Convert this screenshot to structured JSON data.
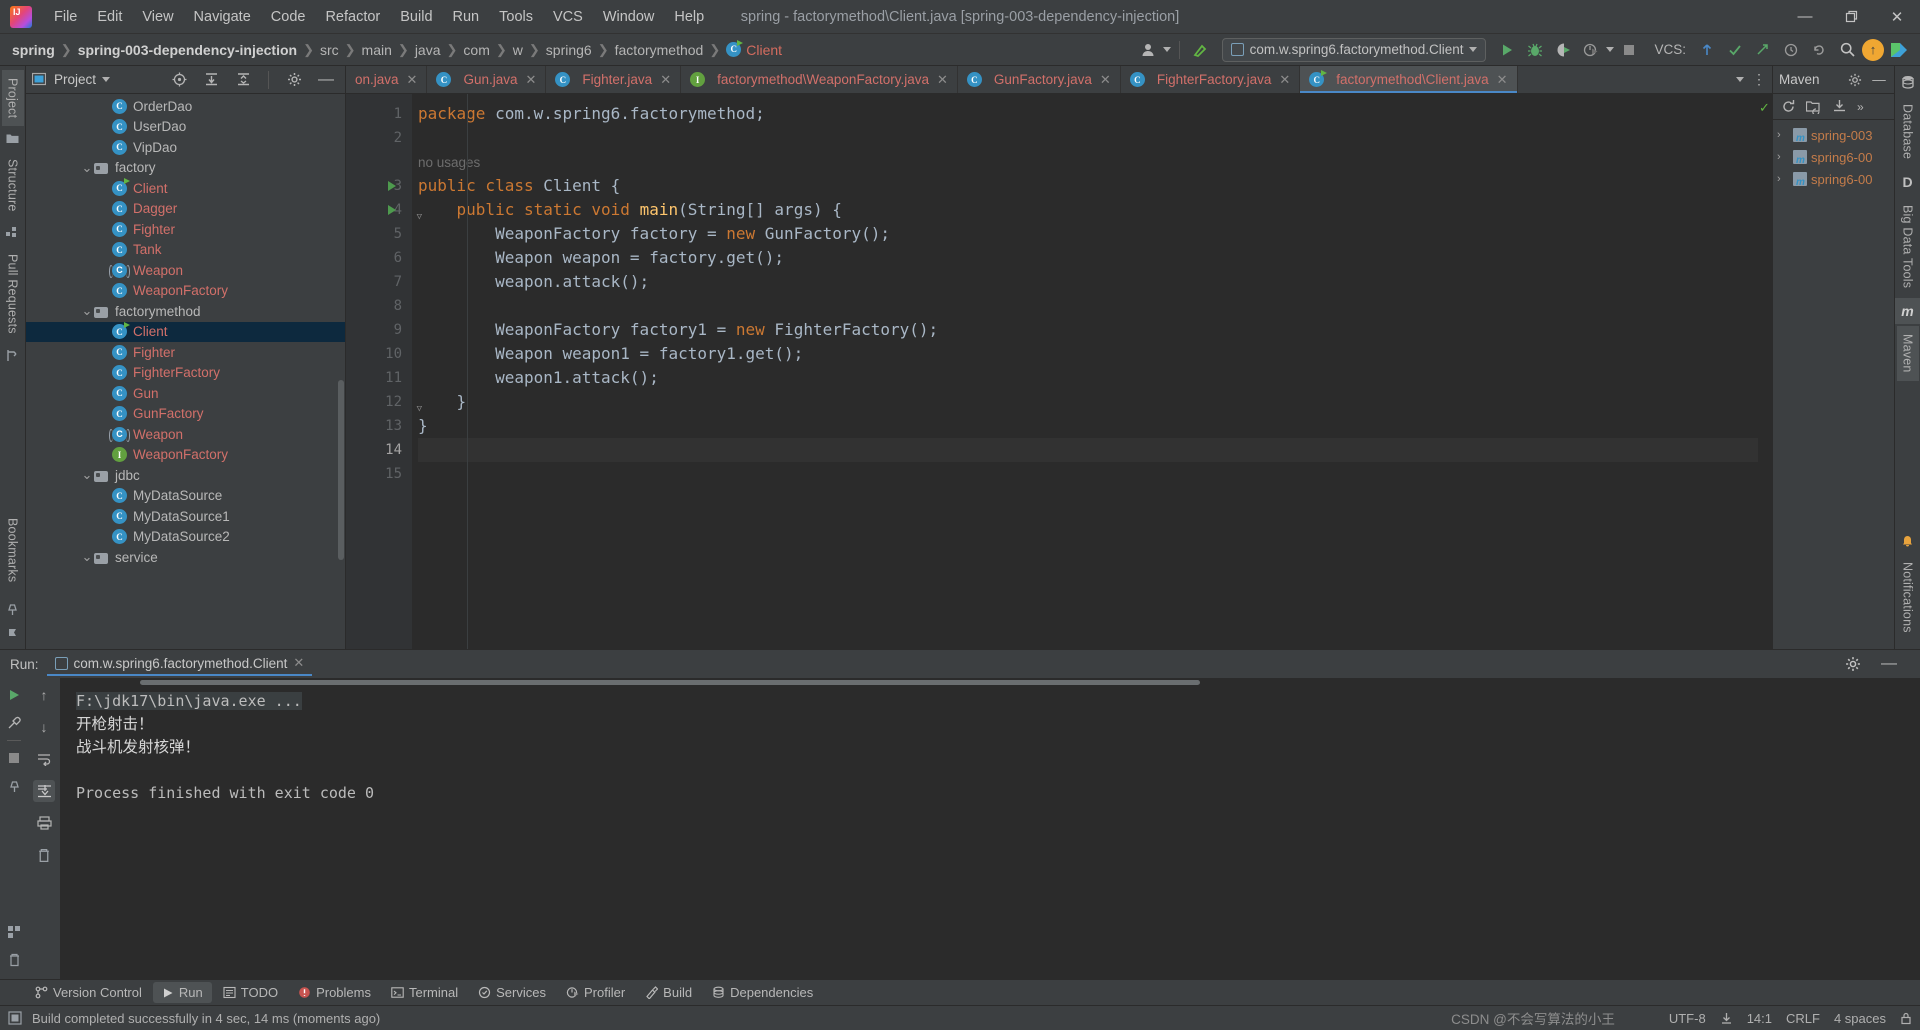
{
  "window": {
    "title": "spring - factorymethod\\Client.java [spring-003-dependency-injection]",
    "minimize": "—",
    "maximize": "❐",
    "close": "✕"
  },
  "menu": [
    "File",
    "Edit",
    "View",
    "Navigate",
    "Code",
    "Refactor",
    "Build",
    "Run",
    "Tools",
    "VCS",
    "Window",
    "Help"
  ],
  "breadcrumbs": [
    {
      "label": "spring",
      "bold": true
    },
    {
      "label": "spring-003-dependency-injection",
      "bold": true
    },
    {
      "label": "src",
      "bold": false
    },
    {
      "label": "main",
      "bold": false
    },
    {
      "label": "java",
      "bold": false
    },
    {
      "label": "com",
      "bold": false
    },
    {
      "label": "w",
      "bold": false
    },
    {
      "label": "spring6",
      "bold": false
    },
    {
      "label": "factorymethod",
      "bold": false
    },
    {
      "label": "Client",
      "bold": false,
      "class": true
    }
  ],
  "toolbar": {
    "run_config": "com.w.spring6.factorymethod.Client",
    "run_tooltip": "Run",
    "debug_tooltip": "Debug",
    "coverage_tooltip": "Run with Coverage",
    "profiler_tooltip": "Profiler",
    "stop_tooltip": "Stop",
    "vcs_label": "VCS:",
    "search_tooltip": "Search Everywhere",
    "update_tooltip": "Update Project",
    "settings_tooltip": "Settings",
    "minimize_panel": "—"
  },
  "left_rail": {
    "items": [
      "Project",
      "Structure",
      "Pull Requests",
      "Bookmarks"
    ],
    "active": "Project"
  },
  "right_rail": {
    "items": [
      "Database",
      "Big Data Tools",
      "Maven",
      "Notifications"
    ]
  },
  "project_panel": {
    "title": "Project",
    "tree": [
      {
        "indent": 4,
        "label": "OrderDao",
        "icon": "class-icon",
        "color": "normal",
        "expander": "",
        "selected": false
      },
      {
        "indent": 4,
        "label": "UserDao",
        "icon": "class-icon",
        "color": "normal",
        "expander": "",
        "selected": false
      },
      {
        "indent": 4,
        "label": "VipDao",
        "icon": "class-icon",
        "color": "normal",
        "expander": "",
        "selected": false
      },
      {
        "indent": 3,
        "label": "factory",
        "icon": "folder-icon",
        "color": "normal",
        "expander": "v",
        "selected": false
      },
      {
        "indent": 4,
        "label": "Client",
        "icon": "class-runnable-icon",
        "color": "red",
        "expander": "",
        "selected": false
      },
      {
        "indent": 4,
        "label": "Dagger",
        "icon": "class-icon",
        "color": "red",
        "expander": "",
        "selected": false
      },
      {
        "indent": 4,
        "label": "Fighter",
        "icon": "class-icon",
        "color": "red",
        "expander": "",
        "selected": false
      },
      {
        "indent": 4,
        "label": "Tank",
        "icon": "class-icon",
        "color": "red",
        "expander": "",
        "selected": false
      },
      {
        "indent": 4,
        "label": "Weapon",
        "icon": "interface-icon",
        "color": "red",
        "expander": "",
        "selected": false
      },
      {
        "indent": 4,
        "label": "WeaponFactory",
        "icon": "class-icon",
        "color": "red",
        "expander": "",
        "selected": false
      },
      {
        "indent": 3,
        "label": "factorymethod",
        "icon": "folder-icon",
        "color": "normal",
        "expander": "v",
        "selected": false
      },
      {
        "indent": 4,
        "label": "Client",
        "icon": "class-runnable-icon",
        "color": "red",
        "expander": "",
        "selected": true
      },
      {
        "indent": 4,
        "label": "Fighter",
        "icon": "class-icon",
        "color": "red",
        "expander": "",
        "selected": false
      },
      {
        "indent": 4,
        "label": "FighterFactory",
        "icon": "class-icon",
        "color": "red",
        "expander": "",
        "selected": false
      },
      {
        "indent": 4,
        "label": "Gun",
        "icon": "class-icon",
        "color": "red",
        "expander": "",
        "selected": false
      },
      {
        "indent": 4,
        "label": "GunFactory",
        "icon": "class-icon",
        "color": "red",
        "expander": "",
        "selected": false
      },
      {
        "indent": 4,
        "label": "Weapon",
        "icon": "interface-icon",
        "color": "red",
        "expander": "",
        "selected": false
      },
      {
        "indent": 4,
        "label": "WeaponFactory",
        "icon": "interface-green-icon",
        "color": "red",
        "expander": "",
        "selected": false
      },
      {
        "indent": 3,
        "label": "jdbc",
        "icon": "folder-icon",
        "color": "normal",
        "expander": "v",
        "selected": false
      },
      {
        "indent": 4,
        "label": "MyDataSource",
        "icon": "class-icon",
        "color": "normal",
        "expander": "",
        "selected": false
      },
      {
        "indent": 4,
        "label": "MyDataSource1",
        "icon": "class-icon",
        "color": "normal",
        "expander": "",
        "selected": false
      },
      {
        "indent": 4,
        "label": "MyDataSource2",
        "icon": "class-icon",
        "color": "normal",
        "expander": "",
        "selected": false
      },
      {
        "indent": 3,
        "label": "service",
        "icon": "folder-icon",
        "color": "normal",
        "expander": "v",
        "selected": false
      }
    ]
  },
  "editor_tabs": [
    {
      "label": "on.java",
      "icon": "",
      "active": false,
      "truncated": true
    },
    {
      "label": "Gun.java",
      "icon": "class-icon",
      "active": false
    },
    {
      "label": "Fighter.java",
      "icon": "class-icon",
      "active": false
    },
    {
      "label": "factorymethod\\WeaponFactory.java",
      "icon": "interface-green-icon",
      "active": false
    },
    {
      "label": "GunFactory.java",
      "icon": "class-icon",
      "active": false
    },
    {
      "label": "FighterFactory.java",
      "icon": "class-icon",
      "active": false
    },
    {
      "label": "factorymethod\\Client.java",
      "icon": "class-runnable-icon",
      "active": true
    }
  ],
  "editor": {
    "inlay_hint": "no usages",
    "lines": [
      {
        "n": "1",
        "indent": 0,
        "runnable": false,
        "tokens": [
          {
            "t": "package",
            "c": "kw"
          },
          {
            "t": " com.w.spring6.factorymethod;",
            "c": "plain"
          }
        ]
      },
      {
        "n": "2",
        "indent": 0,
        "runnable": false,
        "tokens": []
      },
      {
        "n": "",
        "indent": 0,
        "runnable": false,
        "hint": "no usages",
        "tokens": []
      },
      {
        "n": "3",
        "indent": 0,
        "runnable": true,
        "tokens": [
          {
            "t": "public class ",
            "c": "kw"
          },
          {
            "t": "Client ",
            "c": "plain"
          },
          {
            "t": "{",
            "c": "plain"
          }
        ]
      },
      {
        "n": "4",
        "indent": 1,
        "runnable": true,
        "fold": true,
        "tokens": [
          {
            "t": "public static void ",
            "c": "kw"
          },
          {
            "t": "main",
            "c": "fn"
          },
          {
            "t": "(String[] args) {",
            "c": "plain"
          }
        ]
      },
      {
        "n": "5",
        "indent": 2,
        "runnable": false,
        "tokens": [
          {
            "t": "WeaponFactory factory = ",
            "c": "plain"
          },
          {
            "t": "new ",
            "c": "kw"
          },
          {
            "t": "GunFactory();",
            "c": "plain"
          }
        ]
      },
      {
        "n": "6",
        "indent": 2,
        "runnable": false,
        "tokens": [
          {
            "t": "Weapon weapon = factory.get();",
            "c": "plain"
          }
        ]
      },
      {
        "n": "7",
        "indent": 2,
        "runnable": false,
        "tokens": [
          {
            "t": "weapon.attack();",
            "c": "plain"
          }
        ]
      },
      {
        "n": "8",
        "indent": 0,
        "runnable": false,
        "tokens": []
      },
      {
        "n": "9",
        "indent": 2,
        "runnable": false,
        "tokens": [
          {
            "t": "WeaponFactory factory1 = ",
            "c": "plain"
          },
          {
            "t": "new ",
            "c": "kw"
          },
          {
            "t": "FighterFactory();",
            "c": "plain"
          }
        ]
      },
      {
        "n": "10",
        "indent": 2,
        "runnable": false,
        "tokens": [
          {
            "t": "Weapon weapon1 = factory1.get();",
            "c": "plain"
          }
        ]
      },
      {
        "n": "11",
        "indent": 2,
        "runnable": false,
        "tokens": [
          {
            "t": "weapon1.attack();",
            "c": "plain"
          }
        ]
      },
      {
        "n": "12",
        "indent": 1,
        "runnable": false,
        "fold": true,
        "tokens": [
          {
            "t": "}",
            "c": "plain"
          }
        ]
      },
      {
        "n": "13",
        "indent": 0,
        "runnable": false,
        "tokens": [
          {
            "t": "}",
            "c": "plain"
          }
        ]
      },
      {
        "n": "14",
        "indent": 0,
        "runnable": false,
        "current": true,
        "tokens": []
      },
      {
        "n": "15",
        "indent": 0,
        "runnable": false,
        "tokens": []
      }
    ]
  },
  "maven_panel": {
    "title": "Maven",
    "projects": [
      "spring-003",
      "spring6-00",
      "spring6-00"
    ],
    "reload_tooltip": "Reload All Maven Projects",
    "add_tooltip": "Add Maven Project",
    "download_tooltip": "Download Sources",
    "more": "»"
  },
  "run_panel": {
    "label": "Run:",
    "tab": "com.w.spring6.factorymethod.Client",
    "close": "✕",
    "console": [
      {
        "text": "F:\\jdk17\\bin\\java.exe ...",
        "style": "cmd"
      },
      {
        "text": "开枪射击！",
        "style": "cn"
      },
      {
        "text": "战斗机发射核弹！",
        "style": "cn"
      },
      {
        "text": "",
        "style": "plain"
      },
      {
        "text": "Process finished with exit code 0",
        "style": "plain"
      }
    ]
  },
  "bottom_toolbar": [
    {
      "label": "Version Control",
      "icon": "branch-icon",
      "active": false
    },
    {
      "label": "Run",
      "icon": "play-icon",
      "active": true
    },
    {
      "label": "TODO",
      "icon": "todo-icon",
      "active": false
    },
    {
      "label": "Problems",
      "icon": "problems-icon",
      "active": false
    },
    {
      "label": "Terminal",
      "icon": "terminal-icon",
      "active": false
    },
    {
      "label": "Services",
      "icon": "services-icon",
      "active": false
    },
    {
      "label": "Profiler",
      "icon": "profiler-icon",
      "active": false
    },
    {
      "label": "Build",
      "icon": "build-icon",
      "active": false
    },
    {
      "label": "Dependencies",
      "icon": "dependencies-icon",
      "active": false
    }
  ],
  "statusbar": {
    "message": "Build completed successfully in 4 sec, 14 ms (moments ago)",
    "encoding": "UTF-8",
    "position": "14:1",
    "line_sep": "CRLF",
    "indent": "4 spaces",
    "watermark": "CSDN @不会写算法的小王"
  },
  "colors": {
    "accent": "#4a88c7",
    "red_file": "#d2706a",
    "green_run": "#62b543",
    "orange_kw": "#cc7832",
    "selection": "#0d293e"
  }
}
